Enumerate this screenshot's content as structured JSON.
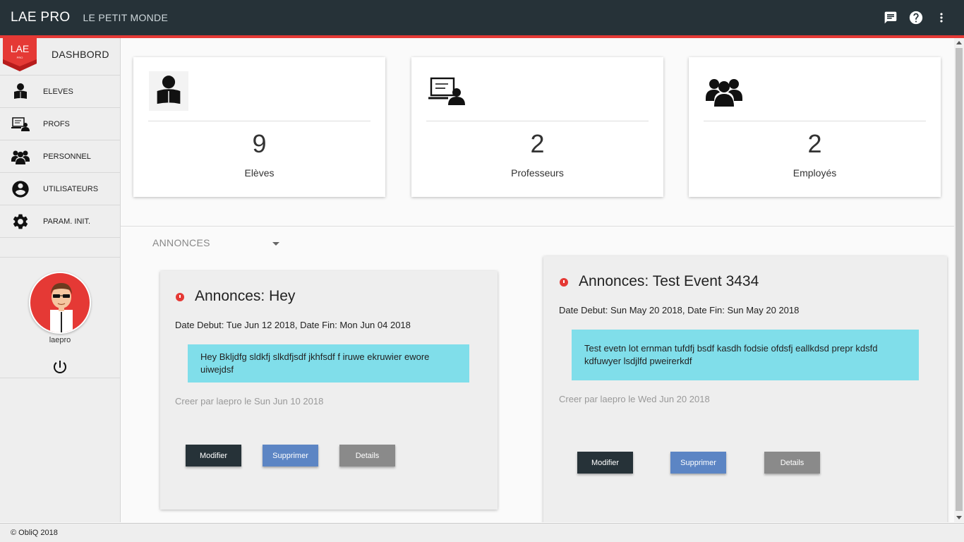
{
  "header": {
    "app_title": "LAE PRO",
    "subtitle": "LE PETIT MONDE",
    "icons": [
      "chat-icon",
      "help-icon",
      "more-vert-icon"
    ],
    "accent_color": "#e53935",
    "bar_color": "#263238"
  },
  "sidebar": {
    "logo_text": "LAE",
    "logo_small": "PRO",
    "dashboard_label": "DASHBORD",
    "items": [
      {
        "label": "ELEVES",
        "icon": "student-reading-icon"
      },
      {
        "label": "PROFS",
        "icon": "teacher-board-icon"
      },
      {
        "label": "PERSONNEL",
        "icon": "group-icon"
      },
      {
        "label": "UTILISATEURS",
        "icon": "account-circle-icon"
      },
      {
        "label": "PARAM. INIT.",
        "icon": "gear-icon"
      }
    ],
    "user": {
      "name": "laepro"
    }
  },
  "stats": [
    {
      "value": "9",
      "caption": "Elèves",
      "icon": "student-reading-icon"
    },
    {
      "value": "2",
      "caption": "Professeurs",
      "icon": "teacher-board-icon"
    },
    {
      "value": "2",
      "caption": "Employés",
      "icon": "group-icon"
    }
  ],
  "announcements": {
    "selector_label": "ANNONCES",
    "cards": [
      {
        "title": "Annonces: Hey",
        "dates": "Date Debut: Tue Jun 12 2018, Date Fin: Mon Jun 04 2018",
        "message": "Hey Bkljdfg sldkfj slkdfjsdf jkhfsdf f iruwe ekruwier ewore uiwejdsf",
        "meta": "Creer par laepro le Sun Jun 10 2018",
        "buttons": {
          "edit": "Modifier",
          "delete": "Supprimer",
          "details": "Details"
        }
      },
      {
        "title": "Annonces: Test Event 3434",
        "dates": "Date Debut: Sun May 20 2018, Date Fin: Sun May 20 2018",
        "message": "Test evetn lot ernman tufdfj bsdf kasdh fodsie ofdsfj eallkdsd prepr kdsfd kdfuwyer lsdjlfd pweirerkdf",
        "meta": "Creer par laepro le Wed Jun 20 2018",
        "buttons": {
          "edit": "Modifier",
          "delete": "Supprimer",
          "details": "Details"
        }
      }
    ]
  },
  "footer": {
    "text": "© ObliQ 2018"
  }
}
